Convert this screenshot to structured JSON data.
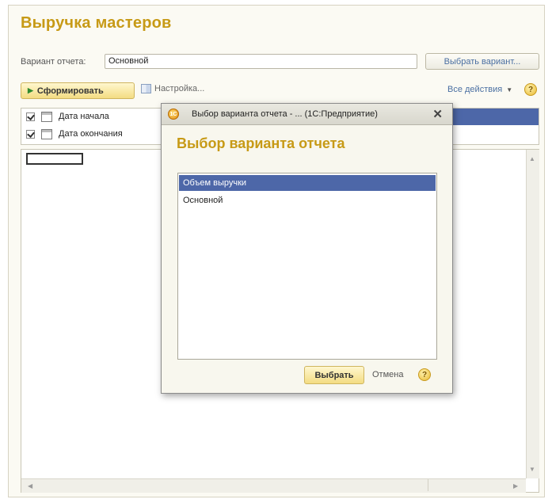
{
  "window": {
    "title": "Выручка мастеров"
  },
  "variant": {
    "label": "Вариант отчета:",
    "value": "Основной",
    "choose_button": "Выбрать вариант..."
  },
  "toolbar": {
    "generate": "Сформировать",
    "settings": "Настройка...",
    "all_actions": "Все действия",
    "help": "?"
  },
  "params": [
    {
      "label": "Дата начала",
      "checked": true
    },
    {
      "label": "Дата окончания",
      "checked": true
    }
  ],
  "dialog": {
    "titlebar": "Выбор варианта отчета - ... (1С:Предприятие)",
    "logo": "1С",
    "close": "✕",
    "heading": "Выбор варианта отчета",
    "items": [
      "Объем выручки",
      "Основной"
    ],
    "selected_index": 0,
    "select_button": "Выбрать",
    "cancel_button": "Отмена",
    "help": "?"
  },
  "icons": [
    "checkbox-icon",
    "calendar-icon",
    "play-icon",
    "settings-icon",
    "help-icon",
    "close-icon",
    "dropdown-icon",
    "scroll-up-icon",
    "scroll-down-icon",
    "scroll-left-icon",
    "scroll-right-icon"
  ],
  "colors": {
    "title": "#c79a16",
    "selection": "#4d67a8",
    "link": "#4a6fa2"
  }
}
